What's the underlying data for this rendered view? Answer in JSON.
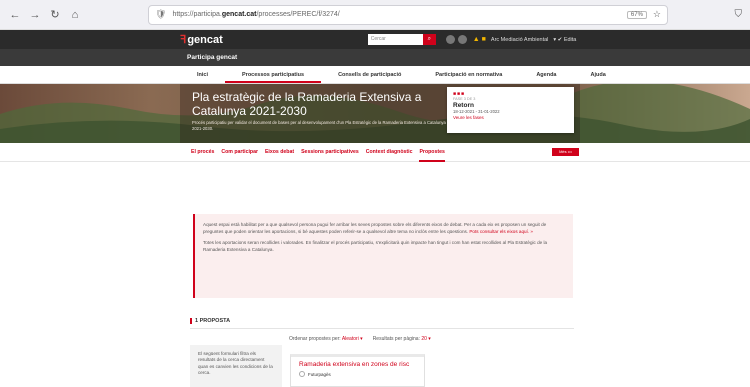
{
  "browser": {
    "url_prefix": "https://participa.",
    "url_domain": "gencat.cat",
    "url_path": "/processes/PEREC/f/3274/",
    "zoom": "67%"
  },
  "header": {
    "logo": "gencat",
    "search_placeholder": "Cercar",
    "user_label": "Arc Mediació Ambiental",
    "edit_label": "Edita"
  },
  "site_bar": {
    "title": "Participa gencat"
  },
  "nav": {
    "items": [
      {
        "label": "Inici"
      },
      {
        "label": "Processos participatius"
      },
      {
        "label": "Consells de participació"
      },
      {
        "label": "Participació en normativa"
      },
      {
        "label": "Agenda"
      },
      {
        "label": "Ajuda"
      }
    ]
  },
  "hero": {
    "title": "Pla estratègic de la Ramaderia Extensiva a Catalunya 2021-2030",
    "subtitle": "Procés participatiu per validar el document de bases per al desenvolupament d'un Pla Estratègic de la Ramaderia Extensiva a Catalunya 2021-2030.",
    "phase_card": {
      "phase_label": "FASE 3 DE 3",
      "title": "Retorn",
      "dates": "18-12-2021 - 31-01-2022",
      "link": "Veure les fases"
    }
  },
  "subnav": {
    "items": [
      {
        "label": "El procés"
      },
      {
        "label": "Com participar"
      },
      {
        "label": "Eixos debat"
      },
      {
        "label": "Sessions participatives"
      },
      {
        "label": "Context diagnòstic"
      },
      {
        "label": "Propostes"
      }
    ],
    "more_label": "Més •••"
  },
  "notice": {
    "p1": "Aquest espai està habilitat per a que qualsevol persona pugui fer arribar les seves propostes sobre els diferents eixos de debat. Per a cada eix es proposen un seguit de preguntes que poden orientar les aportacions, si bé aquestes poden referir-se a qualsevol altre tema no inclòs entre les qüestions.",
    "p1_link": "Pots consultar els eixos aquí. »",
    "p2": "Totes les aportacions seran recollides i valorades. En finalitzar el procés participatiu, s'explicitarà quin impacte han tingut i com han estat recollides al Pla Estratègic de la Ramaderia Extensiva a Catalunya."
  },
  "proposals": {
    "count_label": "1 PROPOSTA",
    "filter_text": "El següent formulari filtra els resultats de la cerca directament quan es canvien les condicions de la cerca.",
    "order_label": "Ordenar propostes per:",
    "order_value": "Aleatori ▾",
    "per_page_label": "Resultats per pàgina:",
    "per_page_value": "20 ▾",
    "card": {
      "title": "Ramaderia extensiva en zones de risc",
      "author": "Futurpagès"
    }
  }
}
